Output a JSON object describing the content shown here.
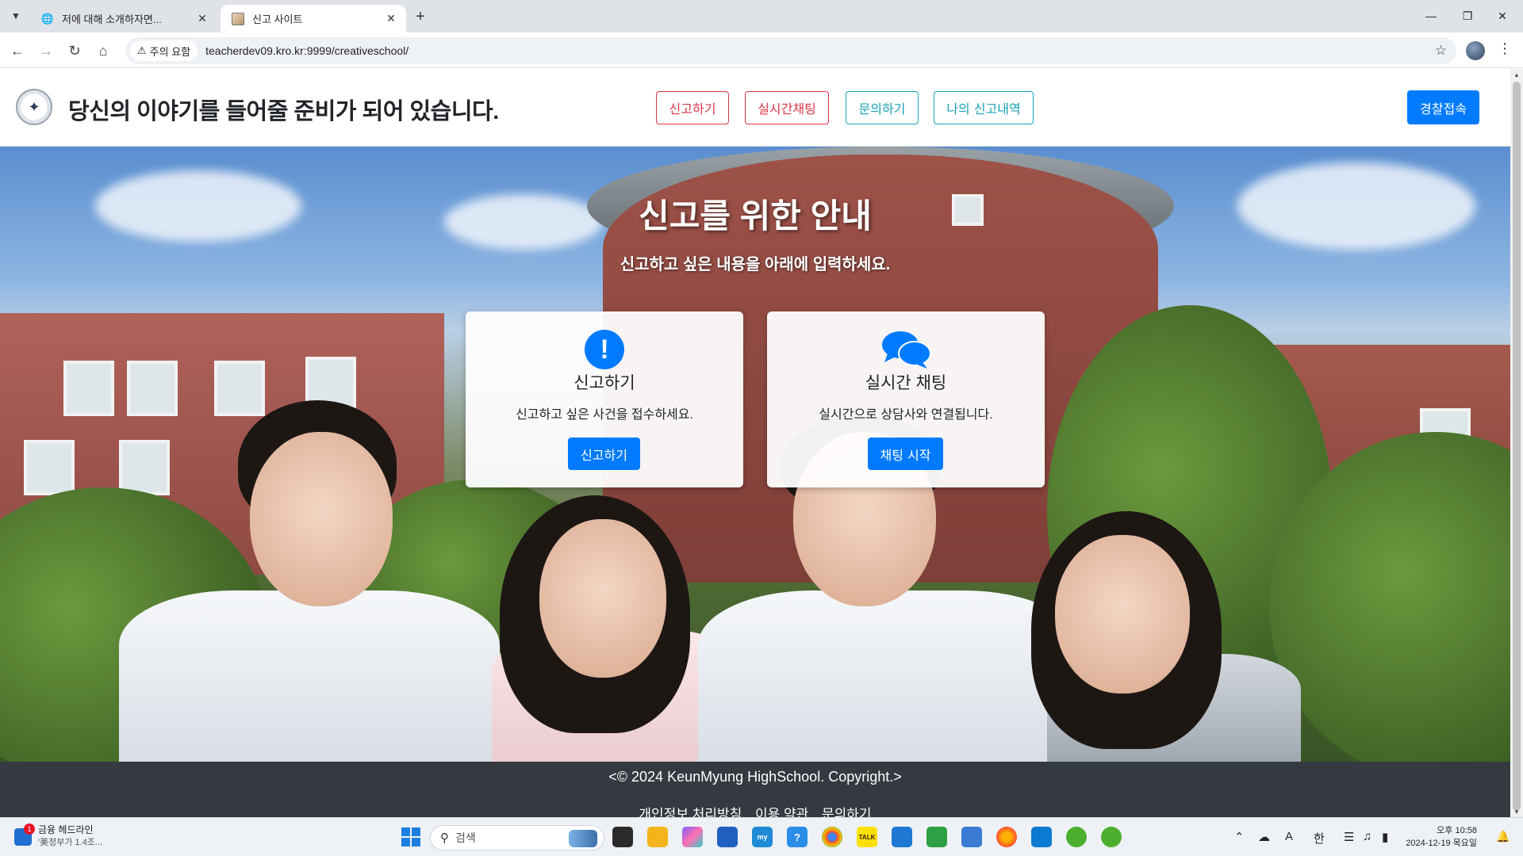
{
  "browser": {
    "tabs": [
      {
        "title": "저에 대해 소개하자면...",
        "active": false
      },
      {
        "title": "신고 사이트",
        "active": true
      }
    ],
    "security_label": "주의 요함",
    "url": "teacherdev09.kro.kr:9999/creativeschool/"
  },
  "header": {
    "title": "당신의 이야기를 들어줄 준비가 되어 있습니다.",
    "nav": [
      "신고하기",
      "실시간채팅",
      "문의하기",
      "나의 신고내역"
    ],
    "police_button": "경찰접속"
  },
  "hero": {
    "title": "신고를 위한 안내",
    "subtitle": "신고하고 싶은 내용을 아래에 입력하세요."
  },
  "cards": [
    {
      "icon": "exclamation-icon",
      "title": "신고하기",
      "text": "신고하고 싶은 사건을 접수하세요.",
      "button": "신고하기"
    },
    {
      "icon": "chat-bubbles-icon",
      "title": "실시간 채팅",
      "text": "실시간으로 상담사와 연결됩니다.",
      "button": "채팅 시작"
    }
  ],
  "footer": {
    "copyright": "<© 2024 KeunMyung HighSchool. Copyright.>",
    "links": [
      "개인정보 처리방침",
      "이용 약관",
      "문의하기"
    ]
  },
  "taskbar": {
    "news_badge": "1",
    "news_title": "금융 헤드라인",
    "news_sub": "'美정부가 1.4조...",
    "search_placeholder": "검색",
    "ime_a": "A",
    "ime_lang": "한",
    "time": "오후 10:58",
    "date": "2024-12-19 목요일"
  },
  "colors": {
    "primary": "#007bff",
    "danger": "#dc3545",
    "info": "#17a2b8",
    "footer_bg": "#343a40"
  }
}
